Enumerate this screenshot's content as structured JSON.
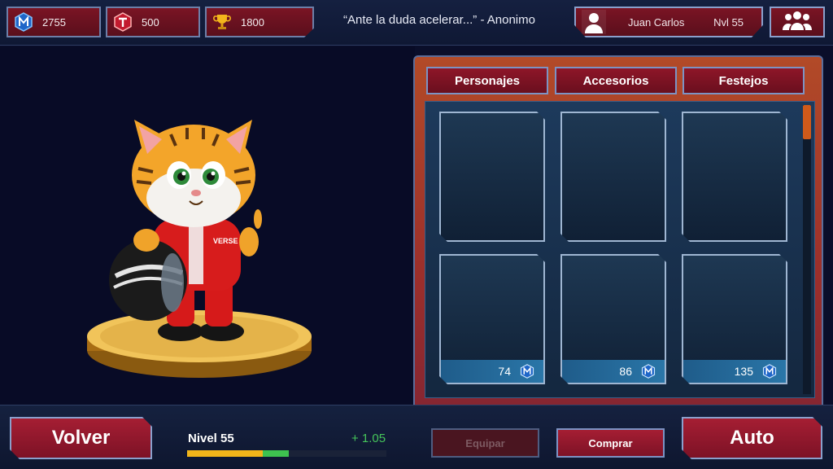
{
  "colors": {
    "accent_red": "#7a1424",
    "panel_orange": "#b24a28",
    "xp_yellow": "#f2b51a",
    "xp_green": "#3ec24f",
    "gain_text": "#45c45a"
  },
  "header": {
    "currencies": [
      {
        "icon": "metaverse-token-icon",
        "value": "2755"
      },
      {
        "icon": "t-token-icon",
        "value": "500"
      },
      {
        "icon": "trophy-icon",
        "value": "1800"
      }
    ],
    "quote": "“Ante la duda acelerar...” - Anonimo",
    "profile": {
      "icon": "user-avatar-icon",
      "name": "Juan Carlos",
      "level": "Nvl 55"
    },
    "friends_icon": "friends-group-icon"
  },
  "panel": {
    "tabs": [
      {
        "label": "Personajes"
      },
      {
        "label": "Accesorios"
      },
      {
        "label": "Festejos"
      }
    ],
    "items": [
      {
        "price": null
      },
      {
        "price": null
      },
      {
        "price": null
      },
      {
        "price": "74",
        "currency_icon": "metaverse-token-icon"
      },
      {
        "price": "86",
        "currency_icon": "metaverse-token-icon"
      },
      {
        "price": "135",
        "currency_icon": "metaverse-token-icon"
      }
    ]
  },
  "character": {
    "name_on_suit": "VERSE",
    "icon": "tiger-racer-character"
  },
  "footer": {
    "back_label": "Volver",
    "auto_label": "Auto",
    "level_label": "Nivel 55",
    "xp_gain": "+ 1.05",
    "xp_progress": 0.38,
    "xp_gain_fraction": 0.13,
    "equip_label": "Equipar",
    "buy_label": "Comprar"
  }
}
